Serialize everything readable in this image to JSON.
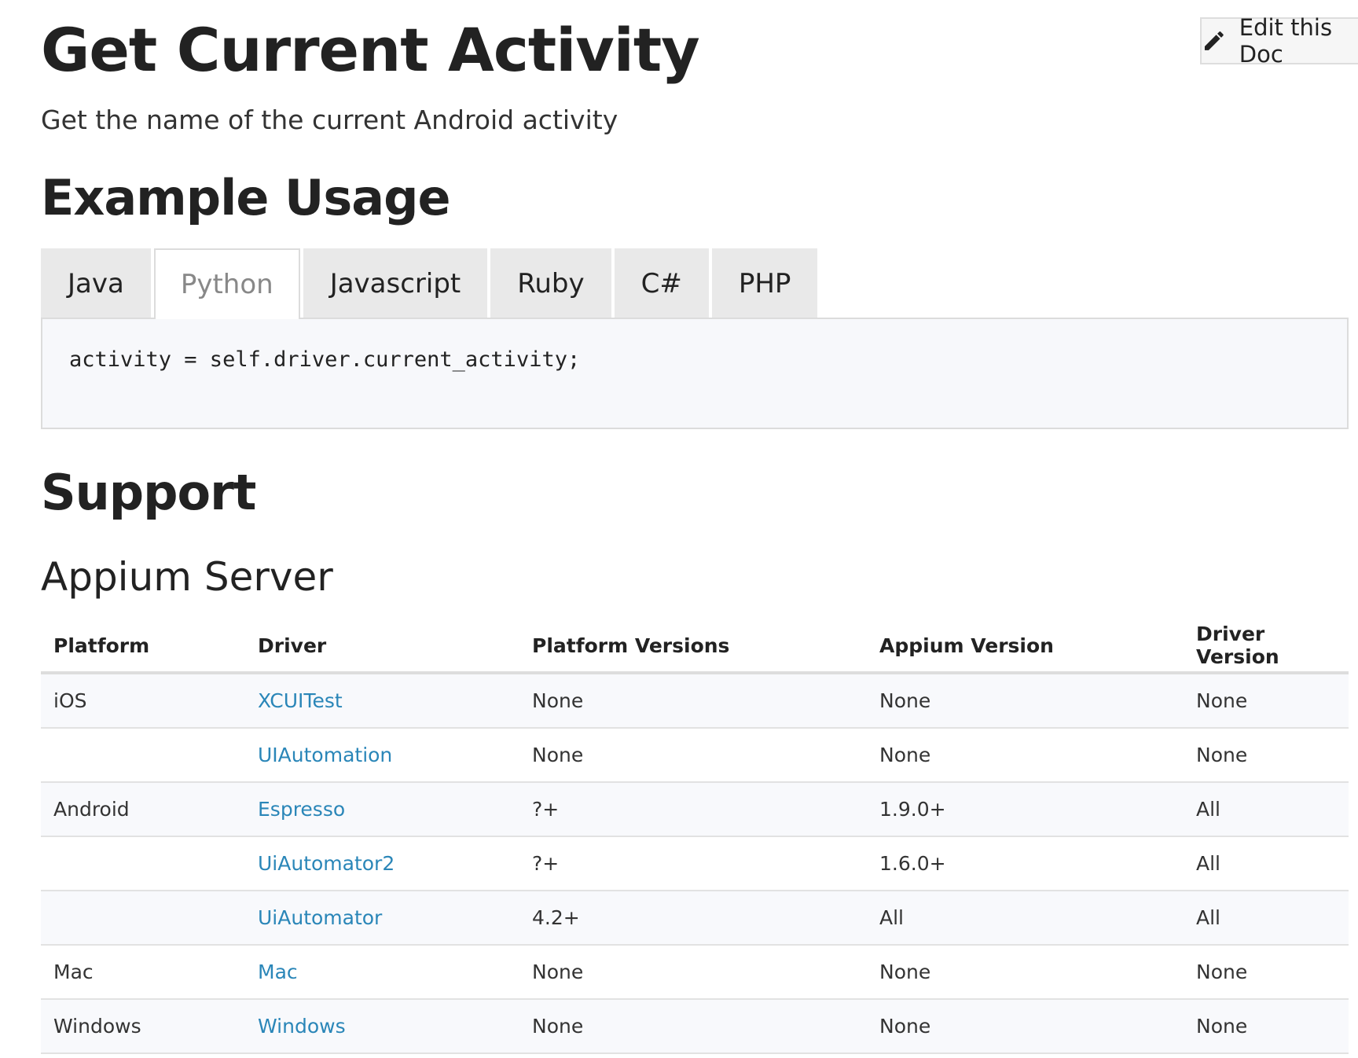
{
  "edit_button": {
    "label": "Edit this Doc",
    "icon": "pencil-icon"
  },
  "title": "Get Current Activity",
  "subtitle": "Get the name of the current Android activity",
  "example": {
    "heading": "Example Usage",
    "tabs": [
      "Java",
      "Python",
      "Javascript",
      "Ruby",
      "C#",
      "PHP"
    ],
    "active_tab": "Python",
    "code": "activity = self.driver.current_activity;"
  },
  "support": {
    "heading": "Support",
    "subheading": "Appium Server",
    "columns": [
      "Platform",
      "Driver",
      "Platform Versions",
      "Appium Version",
      "Driver Version"
    ],
    "rows": [
      {
        "platform": "iOS",
        "driver": "XCUITest",
        "platform_versions": "None",
        "appium_version": "None",
        "driver_version": "None"
      },
      {
        "platform": "",
        "driver": "UIAutomation",
        "platform_versions": "None",
        "appium_version": "None",
        "driver_version": "None"
      },
      {
        "platform": "Android",
        "driver": "Espresso",
        "platform_versions": "?+",
        "appium_version": "1.9.0+",
        "driver_version": "All"
      },
      {
        "platform": "",
        "driver": "UiAutomator2",
        "platform_versions": "?+",
        "appium_version": "1.6.0+",
        "driver_version": "All"
      },
      {
        "platform": "",
        "driver": "UiAutomator",
        "platform_versions": "4.2+",
        "appium_version": "All",
        "driver_version": "All"
      },
      {
        "platform": "Mac",
        "driver": "Mac",
        "platform_versions": "None",
        "appium_version": "None",
        "driver_version": "None"
      },
      {
        "platform": "Windows",
        "driver": "Windows",
        "platform_versions": "None",
        "appium_version": "None",
        "driver_version": "None"
      }
    ]
  },
  "colors": {
    "link": "#2a86b8",
    "tab_bg": "#e9e9e9",
    "code_bg": "#f7f8fb"
  }
}
